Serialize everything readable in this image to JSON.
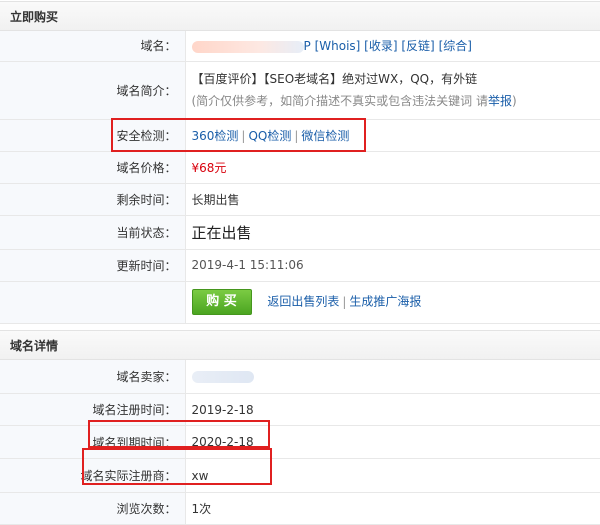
{
  "buy_section": {
    "title": "立即购买"
  },
  "rows": {
    "domain": {
      "label": "域名：",
      "tail": "P",
      "whois": "[Whois]",
      "index": "[收录]",
      "backlink": "[反链]",
      "overall": "[综合]"
    },
    "intro": {
      "label": "域名简介：",
      "text": "【百度评价】【SEO老域名】绝对过WX，QQ，有外链",
      "note_prefix": "(简介仅供参考，如简介描述不真实或包含违法关键词 请",
      "report": "举报",
      "note_suffix": ")"
    },
    "security": {
      "label": "安全检测：",
      "check_360": "360检测",
      "check_qq": "QQ检测",
      "check_wechat": "微信检测"
    },
    "price": {
      "label": "域名价格：",
      "value": "¥68元"
    },
    "remaining": {
      "label": "剩余时间：",
      "value": "长期出售"
    },
    "state": {
      "label": "当前状态：",
      "value": "正在出售"
    },
    "updated": {
      "label": "更新时间：",
      "value": "2019-4-1 15:11:06"
    },
    "actions": {
      "buy": "购 买",
      "back_list": "返回出售列表",
      "poster": "生成推广海报"
    }
  },
  "detail_section": {
    "title": "域名详情"
  },
  "details": {
    "seller": {
      "label": "域名卖家："
    },
    "reg_time": {
      "label": "域名注册时间：",
      "value": "2019-2-18"
    },
    "expire_time": {
      "label": "域名到期时间：",
      "value": "2020-2-18"
    },
    "registrar": {
      "label": "域名实际注册商：",
      "value": "xw"
    },
    "views": {
      "label": "浏览次数：",
      "value": "1次"
    }
  },
  "colors": {
    "link": "#1a5ea9",
    "price": "#d8000c",
    "buy_button": "#5db42f",
    "highlight_box": "#e02020"
  }
}
